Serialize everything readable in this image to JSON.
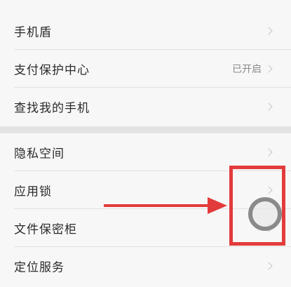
{
  "settings": {
    "group1": [
      {
        "label": "手机盾",
        "value": ""
      },
      {
        "label": "支付保护中心",
        "value": "已开启"
      },
      {
        "label": "查找我的手机",
        "value": ""
      }
    ],
    "group2": [
      {
        "label": "隐私空间",
        "value": ""
      },
      {
        "label": "应用锁",
        "value": ""
      },
      {
        "label": "文件保密柜",
        "value": ""
      },
      {
        "label": "定位服务",
        "value": ""
      }
    ]
  },
  "annotation": {
    "color": "#e33b3b"
  },
  "icons": {
    "chevron": "chevron-right-icon",
    "assist": "assistive-touch-icon"
  }
}
